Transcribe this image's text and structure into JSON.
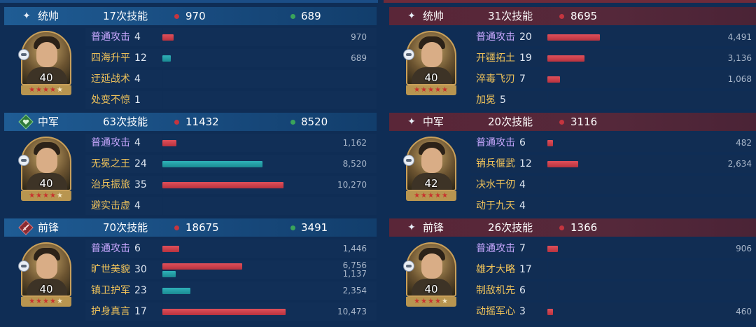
{
  "colors": {
    "damage": "#c4353f",
    "heal": "#3aa45a",
    "basic_skill": "#c9a8ff",
    "skill": "#f0c35a"
  },
  "left": [
    {
      "role": "统帅",
      "role_icon": "sparkle-icon",
      "skill_count": "17次技能",
      "damage": "970",
      "heal": "689",
      "portrait": {
        "level": "40",
        "stars_filled": 4,
        "stars_total": 5
      },
      "skills": [
        {
          "name": "普通攻击",
          "count": "4",
          "basic": true,
          "bars": [
            {
              "type": "damage",
              "value": 970,
              "label": "970"
            }
          ]
        },
        {
          "name": "四海升平",
          "count": "12",
          "basic": false,
          "bars": [
            {
              "type": "heal",
              "value": 689,
              "label": "689"
            }
          ]
        },
        {
          "name": "迂延战术",
          "count": "4",
          "basic": false,
          "bars": []
        },
        {
          "name": "处变不惊",
          "count": "1",
          "basic": false,
          "bars": []
        }
      ]
    },
    {
      "role": "中军",
      "role_icon": "heart-badge-icon",
      "skill_count": "63次技能",
      "damage": "11432",
      "heal": "8520",
      "portrait": {
        "level": "40",
        "stars_filled": 4,
        "stars_total": 5
      },
      "skills": [
        {
          "name": "普通攻击",
          "count": "4",
          "basic": true,
          "bars": [
            {
              "type": "damage",
              "value": 1162,
              "label": "1,162"
            }
          ]
        },
        {
          "name": "无冕之王",
          "count": "24",
          "basic": false,
          "bars": [
            {
              "type": "heal",
              "value": 8520,
              "label": "8,520"
            }
          ]
        },
        {
          "name": "治兵振旅",
          "count": "35",
          "basic": false,
          "bars": [
            {
              "type": "damage",
              "value": 10270,
              "label": "10,270"
            }
          ]
        },
        {
          "name": "避实击虚",
          "count": "4",
          "basic": false,
          "bars": []
        }
      ]
    },
    {
      "role": "前锋",
      "role_icon": "sword-badge-icon",
      "skill_count": "70次技能",
      "damage": "18675",
      "heal": "3491",
      "portrait": {
        "level": "40",
        "stars_filled": 4,
        "stars_total": 5
      },
      "skills": [
        {
          "name": "普通攻击",
          "count": "6",
          "basic": true,
          "bars": [
            {
              "type": "damage",
              "value": 1446,
              "label": "1,446"
            }
          ]
        },
        {
          "name": "旷世美貌",
          "count": "30",
          "basic": false,
          "bars": [
            {
              "type": "damage",
              "value": 6756,
              "label": "6,756"
            },
            {
              "type": "heal",
              "value": 1137,
              "label": "1,137"
            }
          ]
        },
        {
          "name": "镇卫护军",
          "count": "23",
          "basic": false,
          "bars": [
            {
              "type": "heal",
              "value": 2354,
              "label": "2,354"
            }
          ]
        },
        {
          "name": "护身真言",
          "count": "17",
          "basic": false,
          "bars": [
            {
              "type": "damage",
              "value": 10473,
              "label": "10,473"
            }
          ]
        }
      ]
    }
  ],
  "right": [
    {
      "role": "统帅",
      "role_icon": "sparkle-icon",
      "skill_count": "31次技能",
      "damage": "8695",
      "portrait": {
        "level": "40",
        "stars_filled": 5,
        "stars_total": 5
      },
      "skills": [
        {
          "name": "普通攻击",
          "count": "20",
          "basic": true,
          "bars": [
            {
              "type": "damage",
              "value": 4491,
              "label": "4,491"
            }
          ]
        },
        {
          "name": "开疆拓土",
          "count": "19",
          "basic": false,
          "bars": [
            {
              "type": "damage",
              "value": 3136,
              "label": "3,136"
            }
          ]
        },
        {
          "name": "淬毒飞刃",
          "count": "7",
          "basic": false,
          "bars": [
            {
              "type": "damage",
              "value": 1068,
              "label": "1,068"
            }
          ]
        },
        {
          "name": "加冕",
          "count": "5",
          "basic": false,
          "bars": []
        }
      ]
    },
    {
      "role": "中军",
      "role_icon": "sparkle-icon",
      "skill_count": "20次技能",
      "damage": "3116",
      "portrait": {
        "level": "42",
        "stars_filled": 5,
        "stars_total": 5
      },
      "skills": [
        {
          "name": "普通攻击",
          "count": "6",
          "basic": true,
          "bars": [
            {
              "type": "damage",
              "value": 482,
              "label": "482"
            }
          ]
        },
        {
          "name": "销兵偃武",
          "count": "12",
          "basic": false,
          "bars": [
            {
              "type": "damage",
              "value": 2634,
              "label": "2,634"
            }
          ]
        },
        {
          "name": "决水干仞",
          "count": "4",
          "basic": false,
          "bars": []
        },
        {
          "name": "动于九天",
          "count": "4",
          "basic": false,
          "bars": []
        }
      ]
    },
    {
      "role": "前锋",
      "role_icon": "sparkle-icon",
      "skill_count": "26次技能",
      "damage": "1366",
      "portrait": {
        "level": "40",
        "stars_filled": 4,
        "stars_total": 5
      },
      "skills": [
        {
          "name": "普通攻击",
          "count": "7",
          "basic": true,
          "bars": [
            {
              "type": "damage",
              "value": 906,
              "label": "906"
            }
          ]
        },
        {
          "name": "雄才大略",
          "count": "17",
          "basic": false,
          "bars": []
        },
        {
          "name": "制敌机先",
          "count": "6",
          "basic": false,
          "bars": []
        },
        {
          "name": "动摇军心",
          "count": "3",
          "basic": false,
          "bars": [
            {
              "type": "damage",
              "value": 460,
              "label": "460"
            }
          ]
        }
      ]
    }
  ]
}
